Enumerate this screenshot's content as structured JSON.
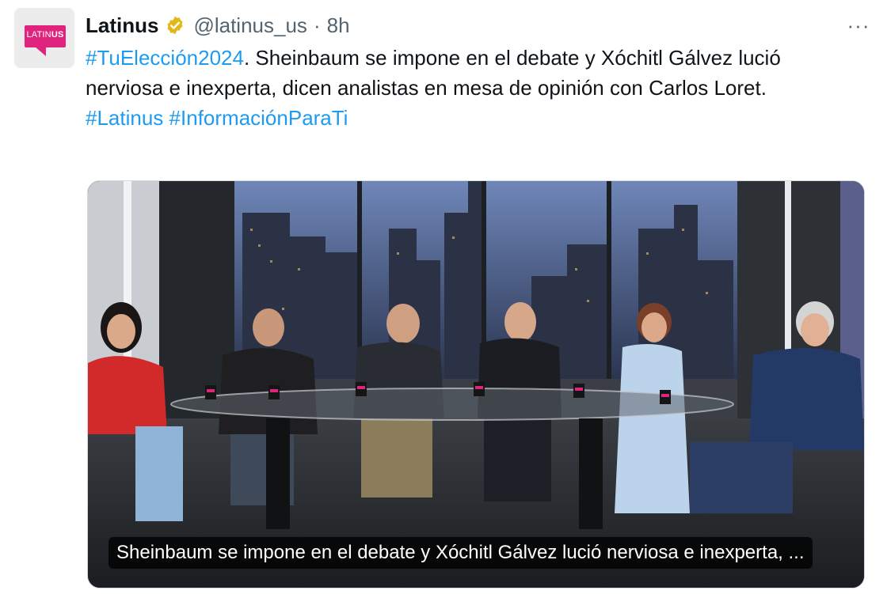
{
  "account": {
    "name": "Latinus",
    "handle": "@latinus_us",
    "time": "8h",
    "separator": "·",
    "logo_text_light": "LATIN",
    "logo_text_bold": "US"
  },
  "tweet": {
    "hashtag_1": "#TuElección2024",
    "body": ". Sheinbaum se impone en el debate y Xóchitl Gálvez lució nerviosa e inexperta, dicen analistas en mesa de opinión con Carlos Loret.",
    "hashtag_2": "#Latinus",
    "hashtag_3": "#InformaciónParaTi"
  },
  "media": {
    "caption": "Sheinbaum se impone en el debate y Xóchitl Gálvez lució nerviosa e inexperta, ..."
  },
  "more_label": "···",
  "colors": {
    "link": "#1d9bf0",
    "brand": "#e0247e",
    "verified": "#e2b719",
    "muted": "#536471"
  }
}
